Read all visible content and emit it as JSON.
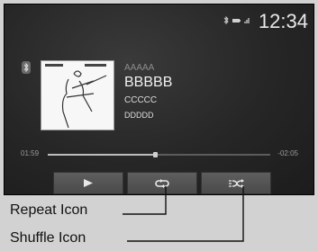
{
  "status": {
    "clock": "12:34",
    "icons": [
      "bluetooth-icon",
      "battery-icon",
      "signal-icon"
    ]
  },
  "track": {
    "line1": "AAAAA",
    "line2": "BBBBB",
    "line3": "CCCCC",
    "line4": "DDDDD",
    "elapsed": "01:59",
    "remaining": "-02:05",
    "progress_fraction": 0.48
  },
  "controls": {
    "play": "play-icon",
    "repeat": "repeat-icon",
    "shuffle": "shuffle-icon"
  },
  "callouts": {
    "repeat": "Repeat Icon",
    "shuffle": "Shuffle Icon"
  }
}
